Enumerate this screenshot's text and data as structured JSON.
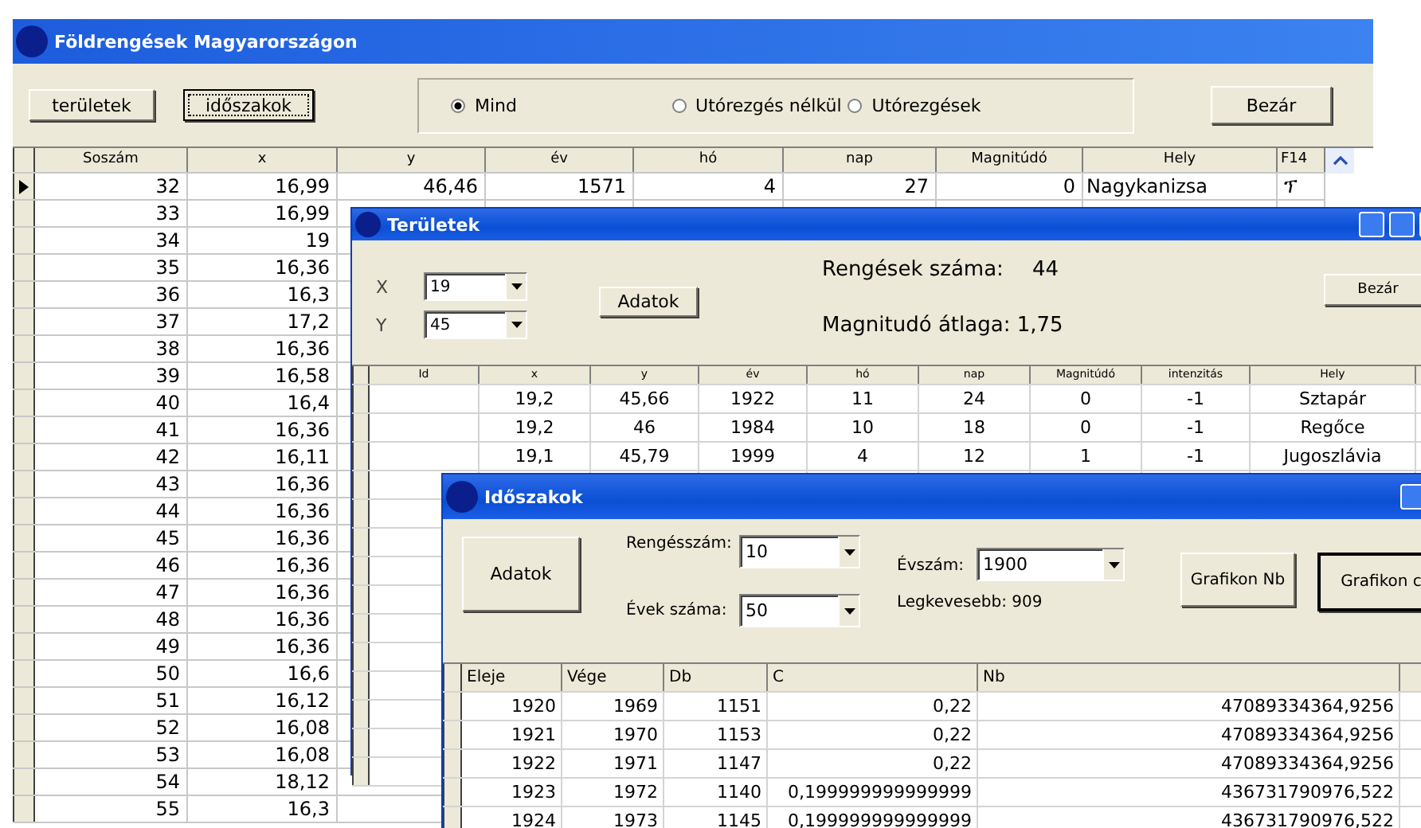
{
  "main_window": {
    "title": "Földrengések Magyarországon",
    "buttons": [
      {
        "label": "területek",
        "focused": false
      },
      {
        "label": "időszakok",
        "focused": true
      }
    ],
    "filter": [
      {
        "label": "Mind",
        "selected": true
      },
      {
        "label": "Utórezgés nélkül",
        "selected": false
      },
      {
        "label": "Utórezgések",
        "selected": false
      }
    ],
    "close_button": "Bezár",
    "table": {
      "columns": [
        "Soszám",
        "x",
        "y",
        "év",
        "hó",
        "nap",
        "Magnitúdó",
        "Hely",
        "F14"
      ],
      "rows": [
        {
          "current": true,
          "cells": [
            "32",
            "16,99",
            "46,46",
            "1571",
            "4",
            "27",
            "0",
            "Nagykanizsa",
            "ፕ"
          ]
        },
        {
          "current": false,
          "cells": [
            "33",
            "16,99"
          ]
        },
        {
          "current": false,
          "cells": [
            "34",
            "19"
          ]
        },
        {
          "current": false,
          "cells": [
            "35",
            "16,36"
          ]
        },
        {
          "current": false,
          "cells": [
            "36",
            "16,3"
          ]
        },
        {
          "current": false,
          "cells": [
            "37",
            "17,2"
          ]
        },
        {
          "current": false,
          "cells": [
            "38",
            "16,36"
          ]
        },
        {
          "current": false,
          "cells": [
            "39",
            "16,58"
          ]
        },
        {
          "current": false,
          "cells": [
            "40",
            "16,4"
          ]
        },
        {
          "current": false,
          "cells": [
            "41",
            "16,36"
          ]
        },
        {
          "current": false,
          "cells": [
            "42",
            "16,11"
          ]
        },
        {
          "current": false,
          "cells": [
            "43",
            "16,36"
          ]
        },
        {
          "current": false,
          "cells": [
            "44",
            "16,36"
          ]
        },
        {
          "current": false,
          "cells": [
            "45",
            "16,36"
          ]
        },
        {
          "current": false,
          "cells": [
            "46",
            "16,36"
          ]
        },
        {
          "current": false,
          "cells": [
            "47",
            "16,36"
          ]
        },
        {
          "current": false,
          "cells": [
            "48",
            "16,36"
          ]
        },
        {
          "current": false,
          "cells": [
            "49",
            "16,36"
          ]
        },
        {
          "current": false,
          "cells": [
            "50",
            "16,6"
          ]
        },
        {
          "current": false,
          "cells": [
            "51",
            "16,12"
          ]
        },
        {
          "current": false,
          "cells": [
            "52",
            "16,08"
          ]
        },
        {
          "current": false,
          "cells": [
            "53",
            "16,08"
          ]
        },
        {
          "current": false,
          "cells": [
            "54",
            "18,12"
          ]
        },
        {
          "current": false,
          "cells": [
            "55",
            "16,3"
          ]
        }
      ]
    }
  },
  "territories_window": {
    "title": "Területek",
    "x_label": "X",
    "x_value": "19",
    "y_label": "Y",
    "y_value": "45",
    "data_button": "Adatok",
    "count_label": "Rengések száma:",
    "count_value": "44",
    "average_text": "Magnitudó átlaga: 1,75",
    "close_button": "Bezár",
    "table": {
      "columns": [
        "Id",
        "x",
        "y",
        "év",
        "hó",
        "nap",
        "Magnitúdó",
        "intenzitás",
        "Hely"
      ],
      "rows": [
        {
          "cells": [
            "",
            "19,2",
            "45,66",
            "1922",
            "11",
            "24",
            "0",
            "-1",
            "Sztapár"
          ]
        },
        {
          "cells": [
            "",
            "19,2",
            "46",
            "1984",
            "10",
            "18",
            "0",
            "-1",
            "Regőce"
          ]
        },
        {
          "cells": [
            "",
            "19,1",
            "45,79",
            "1999",
            "4",
            "12",
            "1",
            "-1",
            "Jugoszlávia"
          ]
        }
      ]
    }
  },
  "periods_window": {
    "title": "Időszakok",
    "data_button": "Adatok",
    "quake_count_label": "Rengésszám:",
    "quake_count_value": "10",
    "years_label": "Évek száma:",
    "years_value": "50",
    "year_label": "Évszám:",
    "year_value": "1900",
    "least_text": "Legkevesebb: 909",
    "buttons": [
      {
        "label": "Grafikon Nb",
        "default": false
      },
      {
        "label": "Grafikon c",
        "default": true
      }
    ],
    "table": {
      "columns": [
        "Eleje",
        "Vége",
        "Db",
        "C",
        "Nb"
      ],
      "rows": [
        {
          "cells": [
            "1920",
            "1969",
            "1151",
            "0,22",
            "47089334364,9256"
          ]
        },
        {
          "cells": [
            "1921",
            "1970",
            "1153",
            "0,22",
            "47089334364,9256"
          ]
        },
        {
          "cells": [
            "1922",
            "1971",
            "1147",
            "0,22",
            "47089334364,9256"
          ]
        },
        {
          "cells": [
            "1923",
            "1972",
            "1140",
            "0,199999999999999",
            "436731790976,522"
          ]
        },
        {
          "cells": [
            "1924",
            "1973",
            "1145",
            "0,199999999999999",
            "436731790976,522"
          ]
        }
      ]
    }
  }
}
